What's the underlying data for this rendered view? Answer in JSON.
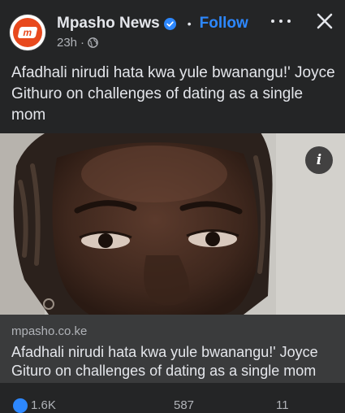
{
  "header": {
    "page_name": "Mpasho News",
    "follow_label": "Follow",
    "time": "23h",
    "separator": "•",
    "meta_dot": "·"
  },
  "post": {
    "caption": "Afadhali nirudi hata kwa yule bwanangu!' Joyce Githuro on challenges of dating as a single mom"
  },
  "link_preview": {
    "domain": "mpasho.co.ke",
    "title": "Afadhali nirudi hata kwa yule bwanangu!' Joyce Gituro on challenges of dating as a single mom"
  },
  "stats": {
    "reactions": "1.6K",
    "comments": "587",
    "shares": "11"
  },
  "colors": {
    "background": "#242526",
    "accent": "#2d88ff",
    "brand": "#e8491d"
  },
  "icons": {
    "verified": "verified-badge-icon",
    "globe": "globe-icon",
    "more": "more-options-icon",
    "close": "close-icon",
    "info": "info-icon"
  }
}
